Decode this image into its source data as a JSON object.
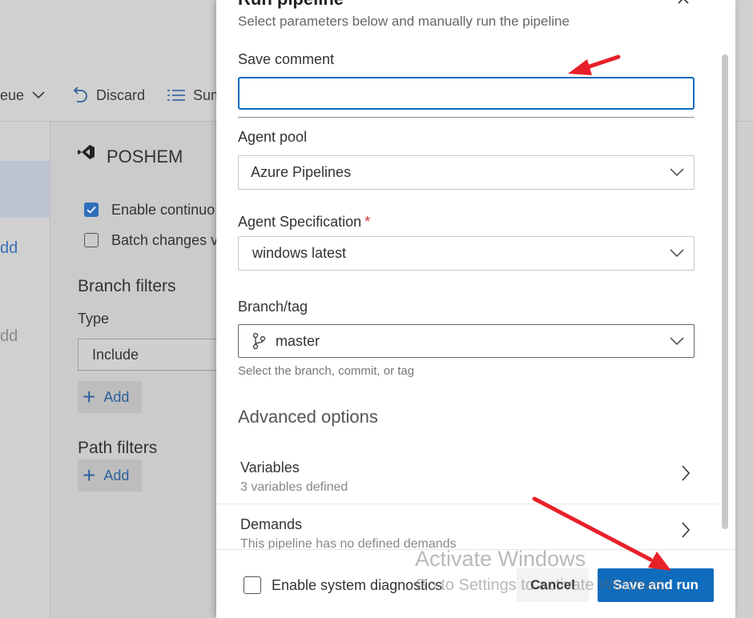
{
  "background": {
    "toolbar": {
      "queue_label": "eue",
      "discard_label": "Discard",
      "summary_label": "Sum"
    },
    "left_nav": {
      "add_1": "dd",
      "add_2": "dd"
    },
    "triggers": {
      "repo_name": "POSHEM",
      "enable_ci_label": "Enable continuo",
      "batch_label": "Batch changes v",
      "branch_filters_heading": "Branch filters",
      "type_label": "Type",
      "type_value": "Include",
      "add_label": "Add",
      "path_filters_heading": "Path filters",
      "path_add_label": "Add"
    }
  },
  "panel": {
    "title": "Run pipeline",
    "subtitle": "Select parameters below and manually run the pipeline",
    "save_comment": {
      "label": "Save comment",
      "value": "",
      "placeholder": ""
    },
    "agent_pool": {
      "label": "Agent pool",
      "value": "Azure Pipelines"
    },
    "agent_spec": {
      "label": "Agent Specification",
      "required_mark": "*",
      "value": "windows latest"
    },
    "branch": {
      "label": "Branch/tag",
      "value": "master",
      "helper": "Select the branch, commit, or tag"
    },
    "advanced_heading": "Advanced options",
    "variables": {
      "title": "Variables",
      "subtitle": "3 variables defined"
    },
    "demands": {
      "title": "Demands",
      "subtitle": "This pipeline has no defined demands"
    },
    "footer": {
      "diagnostics_label": "Enable system diagnostics",
      "diagnostics_checked": false,
      "cancel_label": "Cancel",
      "save_run_label": "Save and run"
    }
  },
  "watermark": {
    "line1": "Activate Windows",
    "line2": "Go to Settings to activate Windows."
  },
  "colors": {
    "accent": "#0f6cbd",
    "annotation_arrow": "#e8202a",
    "required": "#d13438"
  },
  "icons": [
    "chevron-down-icon",
    "discard-icon",
    "list-icon",
    "vs-logo-icon",
    "checkbox-checked-icon",
    "plus-icon",
    "close-icon",
    "branch-icon",
    "chevron-right-icon"
  ]
}
